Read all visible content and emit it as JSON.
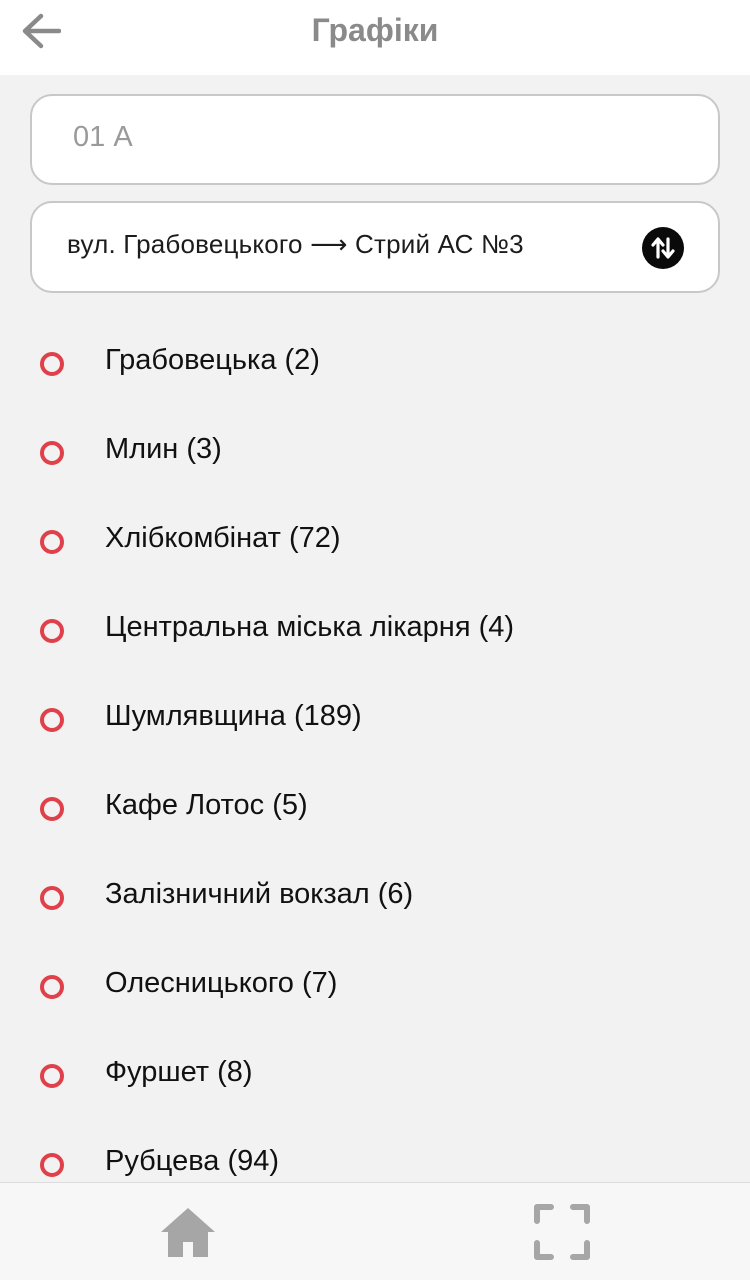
{
  "header": {
    "title": "Графіки",
    "back_icon": "arrow-left-icon"
  },
  "route_input": {
    "placeholder": "01 А"
  },
  "direction": {
    "text": "вул. Грабовецького ⟶ Стрий АС №3",
    "swap_icon": "swap-vertical-icon"
  },
  "stops": [
    {
      "label": "Грабовецька (2)"
    },
    {
      "label": "Млин (3)"
    },
    {
      "label": "Хлібкомбінат (72)"
    },
    {
      "label": "Центральна міська лікарня (4)"
    },
    {
      "label": "Шумлявщина (189)"
    },
    {
      "label": "Кафе Лотос (5)"
    },
    {
      "label": "Залізничний вокзал (6)"
    },
    {
      "label": "Олесницького (7)"
    },
    {
      "label": "Фуршет (8)"
    },
    {
      "label": "Рубцева (94)"
    }
  ],
  "tabbar": {
    "home_icon": "home-icon",
    "scan_icon": "scan-frame-icon"
  },
  "colors": {
    "accent_red": "#e0404a",
    "title_gray": "#8a8a8a",
    "background": "#f2f2f2"
  }
}
